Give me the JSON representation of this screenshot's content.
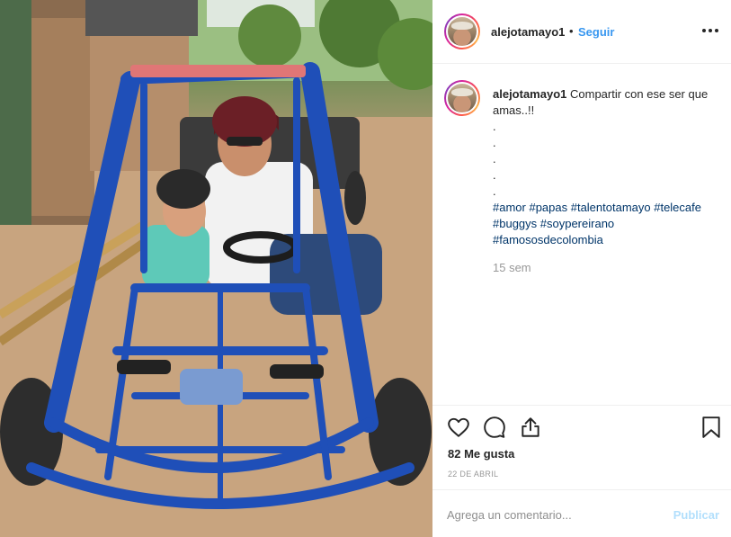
{
  "post": {
    "username": "alejotamayo1",
    "follow_label": "Seguir",
    "separator": "•"
  },
  "caption": {
    "username": "alejotamayo1",
    "text": "Compartir con ese ser que amas..!!",
    "dots": [
      ".",
      ".",
      ".",
      ".",
      "."
    ],
    "hashtags": "#amor #papas #talentotamayo #telecafe #buggys #soypereirano #famososdecolombia",
    "time": "15 sem"
  },
  "actions": {
    "icons": [
      "heart-icon",
      "comment-icon",
      "share-icon",
      "bookmark-icon"
    ],
    "likes": "82 Me gusta",
    "date": "22 DE ABRIL"
  },
  "comment": {
    "placeholder": "Agrega un comentario...",
    "publish_label": "Publicar"
  },
  "colors": {
    "link": "#3897f0",
    "hashtag": "#003569",
    "muted": "#999999",
    "publish_disabled": "#b2dffc",
    "buggy_frame": "#1f4fb8"
  }
}
